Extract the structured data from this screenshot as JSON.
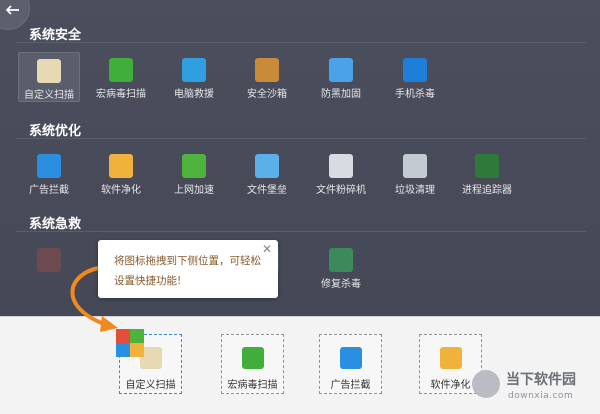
{
  "sections": [
    {
      "title": "系统安全",
      "tools": [
        {
          "label": "自定义扫描",
          "icon": "custom-scan-icon",
          "color": "#e8d9b5",
          "selected": true
        },
        {
          "label": "宏病毒扫描",
          "icon": "macro-virus-scan-icon",
          "color": "#3fae3a"
        },
        {
          "label": "电脑救援",
          "icon": "pc-rescue-icon",
          "color": "#2f9fe0"
        },
        {
          "label": "安全沙箱",
          "icon": "security-sandbox-icon",
          "color": "#c98a3a"
        },
        {
          "label": "防黑加固",
          "icon": "anti-hack-icon",
          "color": "#4aa3e8"
        },
        {
          "label": "手机杀毒",
          "icon": "mobile-antivirus-icon",
          "color": "#1f7fd8"
        }
      ]
    },
    {
      "title": "系统优化",
      "tools": [
        {
          "label": "广告拦截",
          "icon": "ad-block-icon",
          "color": "#2a8fe0"
        },
        {
          "label": "软件净化",
          "icon": "software-clean-icon",
          "color": "#f0b23a"
        },
        {
          "label": "上网加速",
          "icon": "internet-boost-icon",
          "color": "#4db33d"
        },
        {
          "label": "文件堡垒",
          "icon": "file-vault-icon",
          "color": "#5ab0e8"
        },
        {
          "label": "文件粉碎机",
          "icon": "file-shredder-icon",
          "color": "#d8dce2"
        },
        {
          "label": "垃圾清理",
          "icon": "junk-clean-icon",
          "color": "#c4cad2"
        },
        {
          "label": "进程追踪器",
          "icon": "process-tracker-icon",
          "color": "#2e7a3a"
        }
      ]
    },
    {
      "title": "系统急救",
      "tools": [
        {
          "label": "",
          "icon": "multicolor-tool-icon",
          "color": "#e44d3a",
          "dim": true
        },
        {
          "label": "",
          "icon": "hidden-tool-icon",
          "color": "#2a8fe0",
          "dim": true
        },
        {
          "label": "",
          "icon": "hidden-tool-icon",
          "color": "#4db33d",
          "dim": true
        },
        {
          "label": "",
          "icon": "hidden-tool-icon",
          "color": "#5ab0e8",
          "dim": true
        },
        {
          "label": "修复杀毒",
          "icon": "repair-antivirus-icon",
          "color": "#3c8a5c"
        }
      ]
    }
  ],
  "tooltip": {
    "text": "将图标拖拽到下侧位置，可轻松设置快捷功能!",
    "close": "✕"
  },
  "dock": [
    {
      "label": "自定义扫描",
      "icon": "custom-scan-icon",
      "color": "#e8d9b5",
      "active": true
    },
    {
      "label": "宏病毒扫描",
      "icon": "macro-virus-scan-icon",
      "color": "#3fae3a"
    },
    {
      "label": "广告拦截",
      "icon": "ad-block-icon",
      "color": "#2a8fe0"
    },
    {
      "label": "软件净化",
      "icon": "software-clean-icon",
      "color": "#f0b23a"
    }
  ],
  "watermark": {
    "title": "当下软件园",
    "url": "downxia.com"
  }
}
